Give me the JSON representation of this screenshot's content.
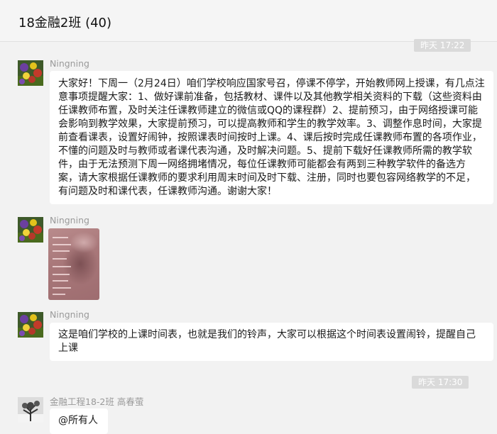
{
  "header": {
    "title": "18金融2班 (40)"
  },
  "timestamps": [
    "昨天 17:22",
    "昨天 17:30"
  ],
  "messages": [
    {
      "sender": "Ningning",
      "avatar": "flowers-avatar",
      "text": "大家好！下周一（2月24日）咱们学校响应国家号召，停课不停学，开始教师网上授课，有几点注意事项提醒大家：1、做好课前准备，包括教材、课件以及其他教学相关资料的下载（这些资料由任课教师布置，及时关注任课教师建立的微信或QQ的课程群）2、提前预习，由于网络授课可能会影响到教学效果，大家提前预习，可以提高教师和学生的教学效率。3、调整作息时间，大家提前查看课表，设置好闹钟，按照课表时间按时上课。4、课后按时完成任课教师布置的各项作业，不懂的问题及时与教师或者课代表沟通，及时解决问题。5、提前下载好任课教师所需的教学软件，由于无法预测下周一网络拥堵情况，每位任课教师可能都会有两到三种教学软件的备选方案，请大家根据任课教师的要求利用周末时间及时下载、注册，同时也要包容网络教学的不足，有问题及时和课代表，任课教师沟通。谢谢大家！"
    },
    {
      "sender": "Ningning",
      "avatar": "flowers-avatar",
      "image": "class-schedule-image"
    },
    {
      "sender": "Ningning",
      "avatar": "flowers-avatar",
      "text": "这是咱们学校的上课时间表，也就是我们的铃声，大家可以根据这个时间表设置闹铃，提醒自己上课"
    },
    {
      "sender": "金融工程18-2班 高春萤",
      "avatar": "winter-tree-avatar",
      "text": "@所有人"
    }
  ]
}
